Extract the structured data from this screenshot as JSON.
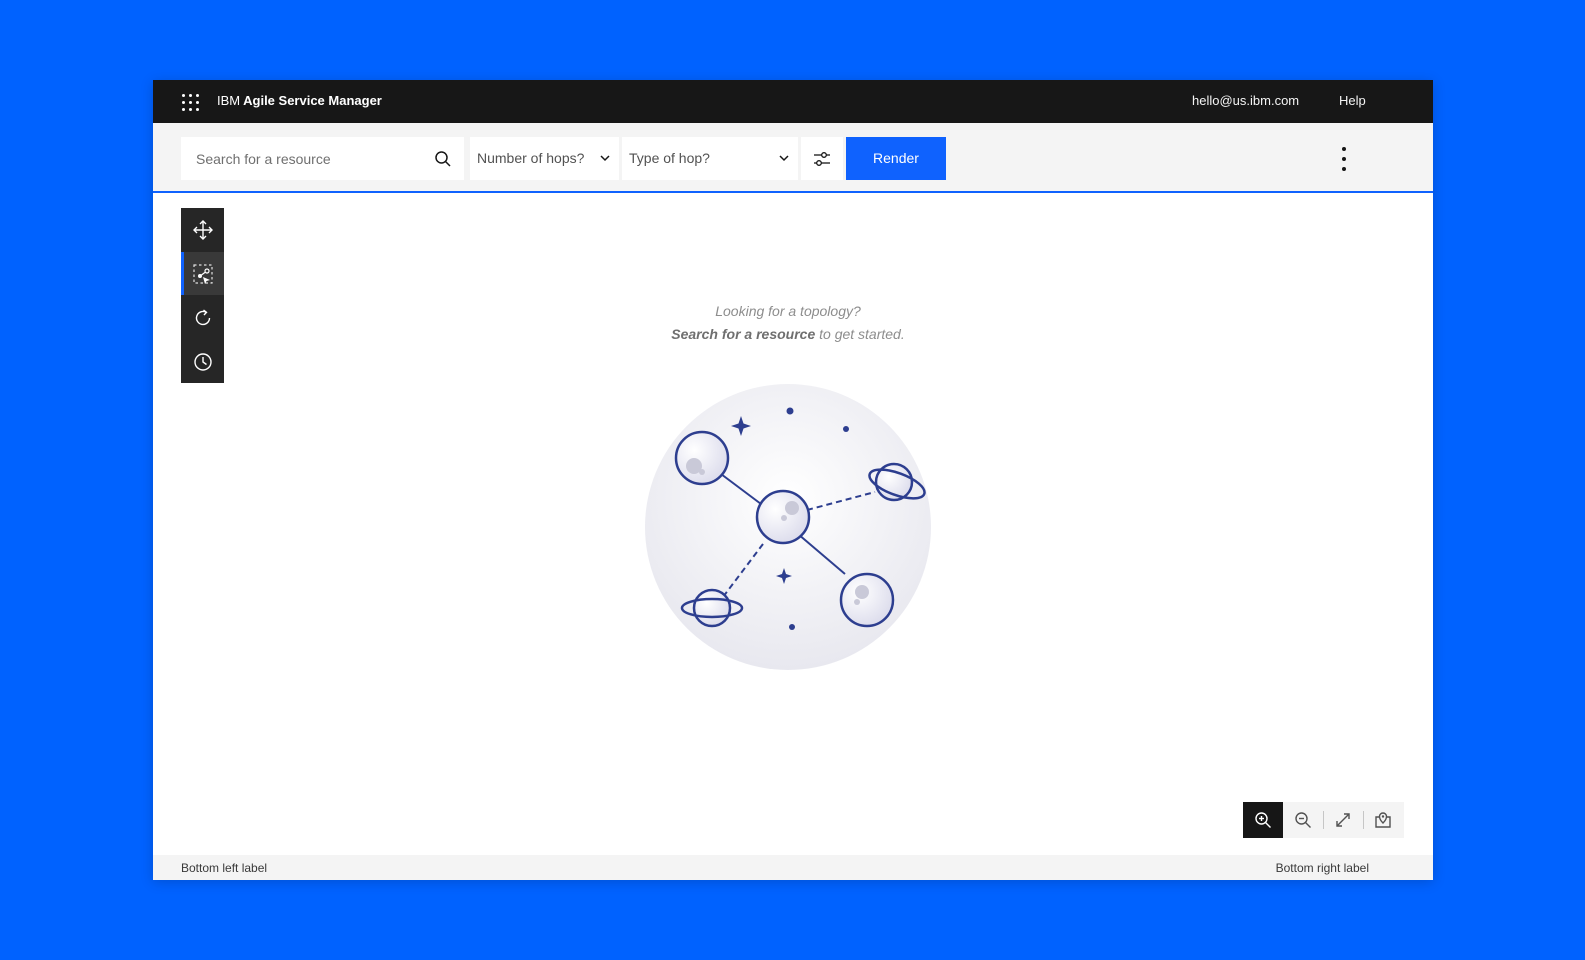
{
  "header": {
    "brand_prefix": "IBM",
    "brand_name": "Agile Service Manager",
    "user_email": "hello@us.ibm.com",
    "help_label": "Help"
  },
  "toolbar": {
    "search_placeholder": "Search for a resource",
    "hops_label": "Number of hops?",
    "hop_type_label": "Type of hop?",
    "render_label": "Render"
  },
  "rail": {
    "items": [
      "move-icon",
      "select-nodes-icon",
      "refresh-icon",
      "history-icon"
    ],
    "active_index": 1
  },
  "empty_state": {
    "line1": "Looking for a topology?",
    "line2_bold": "Search for a resource",
    "line2_rest": " to get started."
  },
  "zoom": {
    "items": [
      "zoom-in-icon",
      "zoom-out-icon",
      "fit-to-screen-icon",
      "locate-icon"
    ],
    "active_index": 0
  },
  "footer": {
    "left_label": "Bottom left label",
    "right_label": "Bottom right label"
  },
  "colors": {
    "page_background": "#0062ff",
    "header_background": "#171717",
    "accent": "#0f62fe",
    "illustration_stroke": "#2d3e8f"
  }
}
